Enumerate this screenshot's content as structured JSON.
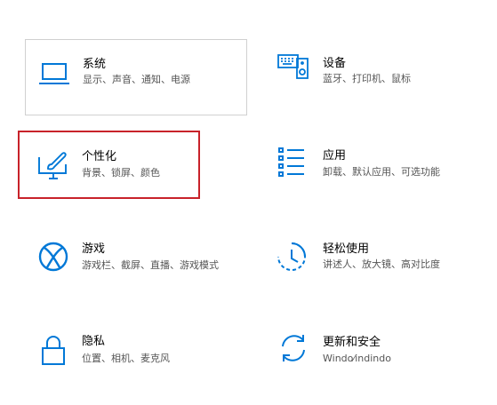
{
  "accent_color": "#0078d7",
  "highlight_color": "#c8222a",
  "tiles": [
    {
      "id": "system",
      "title": "系统",
      "desc": "显示、声音、通知、电源",
      "icon": "laptop-icon"
    },
    {
      "id": "devices",
      "title": "设备",
      "desc": "蓝牙、打印机、鼠标",
      "icon": "devices-icon"
    },
    {
      "id": "personalization",
      "title": "个性化",
      "desc": "背景、锁屏、颜色",
      "icon": "personalization-icon",
      "highlighted": true
    },
    {
      "id": "apps",
      "title": "应用",
      "desc": "卸载、默认应用、可选功能",
      "icon": "apps-list-icon"
    },
    {
      "id": "gaming",
      "title": "游戏",
      "desc": "游戏栏、截屏、直播、游戏模式",
      "icon": "xbox-icon"
    },
    {
      "id": "ease",
      "title": "轻松使用",
      "desc": "讲述人、放大镜、高对比度",
      "icon": "ease-of-access-icon"
    },
    {
      "id": "privacy",
      "title": "隐私",
      "desc": "位置、相机、麦克风",
      "icon": "lock-icon"
    },
    {
      "id": "update",
      "title": "更新和安全",
      "desc": "Windo⁄indindo",
      "icon": "sync-icon"
    }
  ]
}
